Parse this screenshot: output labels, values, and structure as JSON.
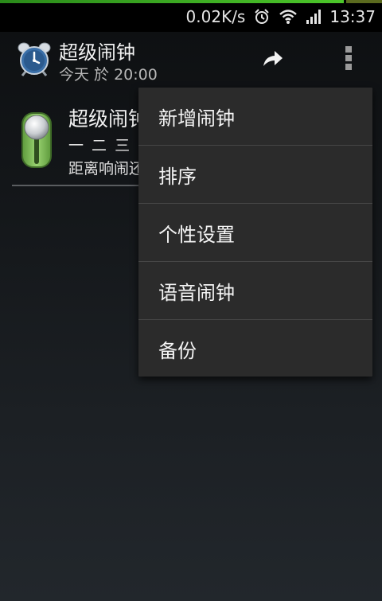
{
  "status_bar": {
    "speed": "0.02K/s",
    "time": "13:37",
    "icons": [
      "alarm-clock-icon",
      "wifi-icon",
      "signal-icon"
    ],
    "progress": 0.9
  },
  "action_bar": {
    "app_title": "超级闹钟",
    "subtitle": "今天 於 20:00",
    "icons": [
      "alarm-clock-app-icon",
      "share-icon",
      "overflow-menu-icon"
    ]
  },
  "alarm_item": {
    "title": "超级闹钟",
    "days": "一 二 三",
    "countdown": "距离响闹还",
    "enabled": true
  },
  "menu": {
    "items": [
      {
        "label": "新增闹钟"
      },
      {
        "label": "排序"
      },
      {
        "label": "个性设置"
      },
      {
        "label": "语音闹钟"
      },
      {
        "label": "备份"
      }
    ]
  },
  "colors": {
    "background": "#14171a",
    "menu_bg": "#2b2b2b",
    "progress_green": "#4cc62a",
    "toggle_green": "#7fc25a"
  }
}
